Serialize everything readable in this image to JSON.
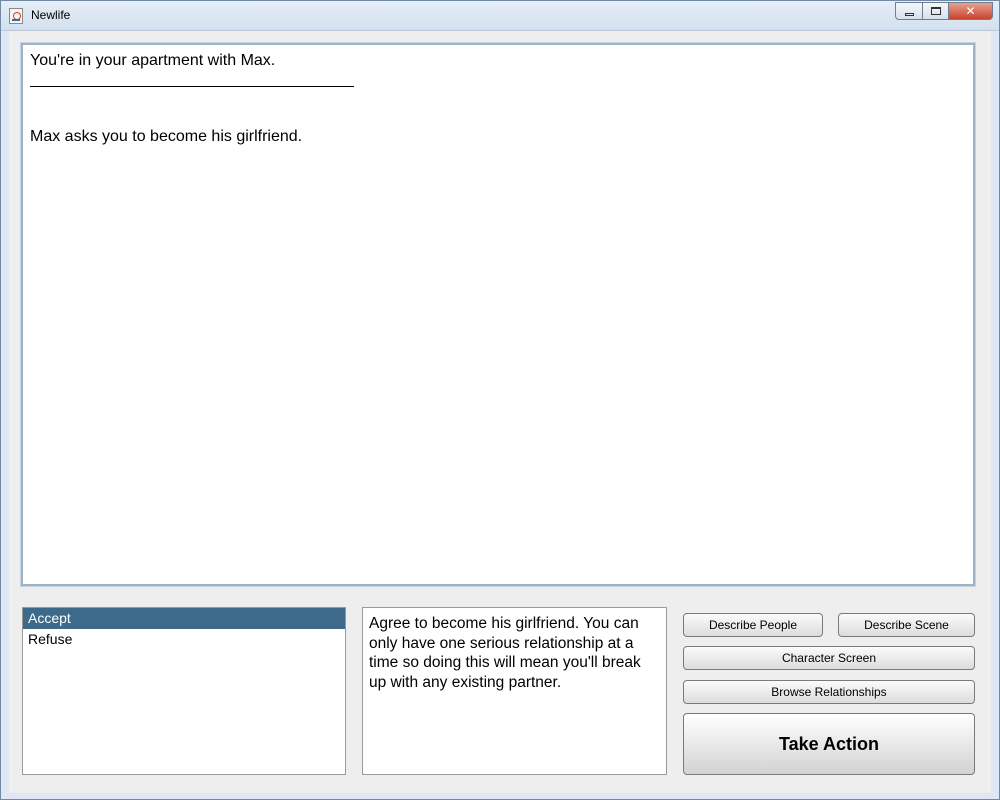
{
  "window": {
    "title": "Newlife"
  },
  "story": {
    "location_text": "You're in your apartment with Max.",
    "event_text": "Max asks you to become his girlfriend."
  },
  "choices": {
    "items": [
      {
        "label": "Accept",
        "selected": true
      },
      {
        "label": "Refuse",
        "selected": false
      }
    ]
  },
  "description": {
    "text": "Agree to become his girlfriend. You can only have one serious relationship at a time so doing this will mean you'll break up with any existing partner."
  },
  "buttons": {
    "describe_people": "Describe People",
    "describe_scene": "Describe Scene",
    "character_screen": "Character Screen",
    "browse_relationships": "Browse Relationships",
    "take_action": "Take Action"
  },
  "colors": {
    "selection": "#3d6a8a",
    "window_frame": "#dfe8f2",
    "close_button": "#c8442b"
  }
}
